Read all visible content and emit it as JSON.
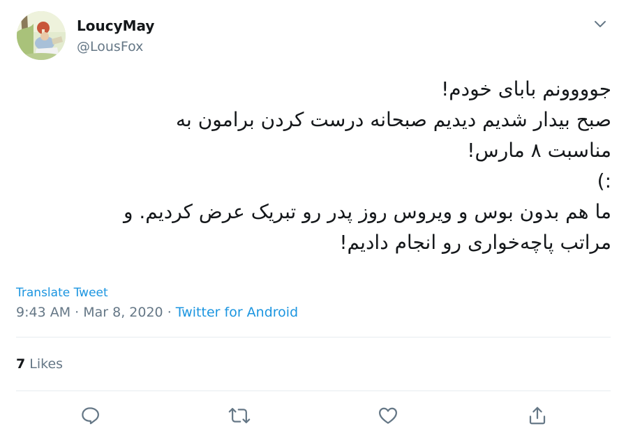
{
  "user": {
    "display_name": "LoucyMay",
    "handle": "@LousFox"
  },
  "tweet": {
    "lines": [
      "جوووونم بابای خودم!",
      "صبح بیدار شدیم دیدیم صبحانه درست کردن برامون به",
      "مناسبت ۸ مارس!",
      ":)",
      "ما هم بدون بوس و ویروس روز پدر رو تبریک عرض کردیم. و",
      "مراتب پاچه‌خواری رو انجام دادیم!"
    ]
  },
  "translate_label": "Translate Tweet",
  "meta": {
    "time": "9:43 AM",
    "separator": " · ",
    "date": "Mar 8, 2020",
    "source": "Twitter for Android"
  },
  "likes": {
    "count": "7",
    "label": "Likes"
  },
  "icons": {
    "more": "chevron-down-icon",
    "reply": "reply-icon",
    "retweet": "retweet-icon",
    "like": "heart-icon",
    "share": "share-icon"
  },
  "colors": {
    "text": "#14171a",
    "secondary": "#657786",
    "link": "#1b95e0",
    "divider": "#e6ecf0"
  }
}
